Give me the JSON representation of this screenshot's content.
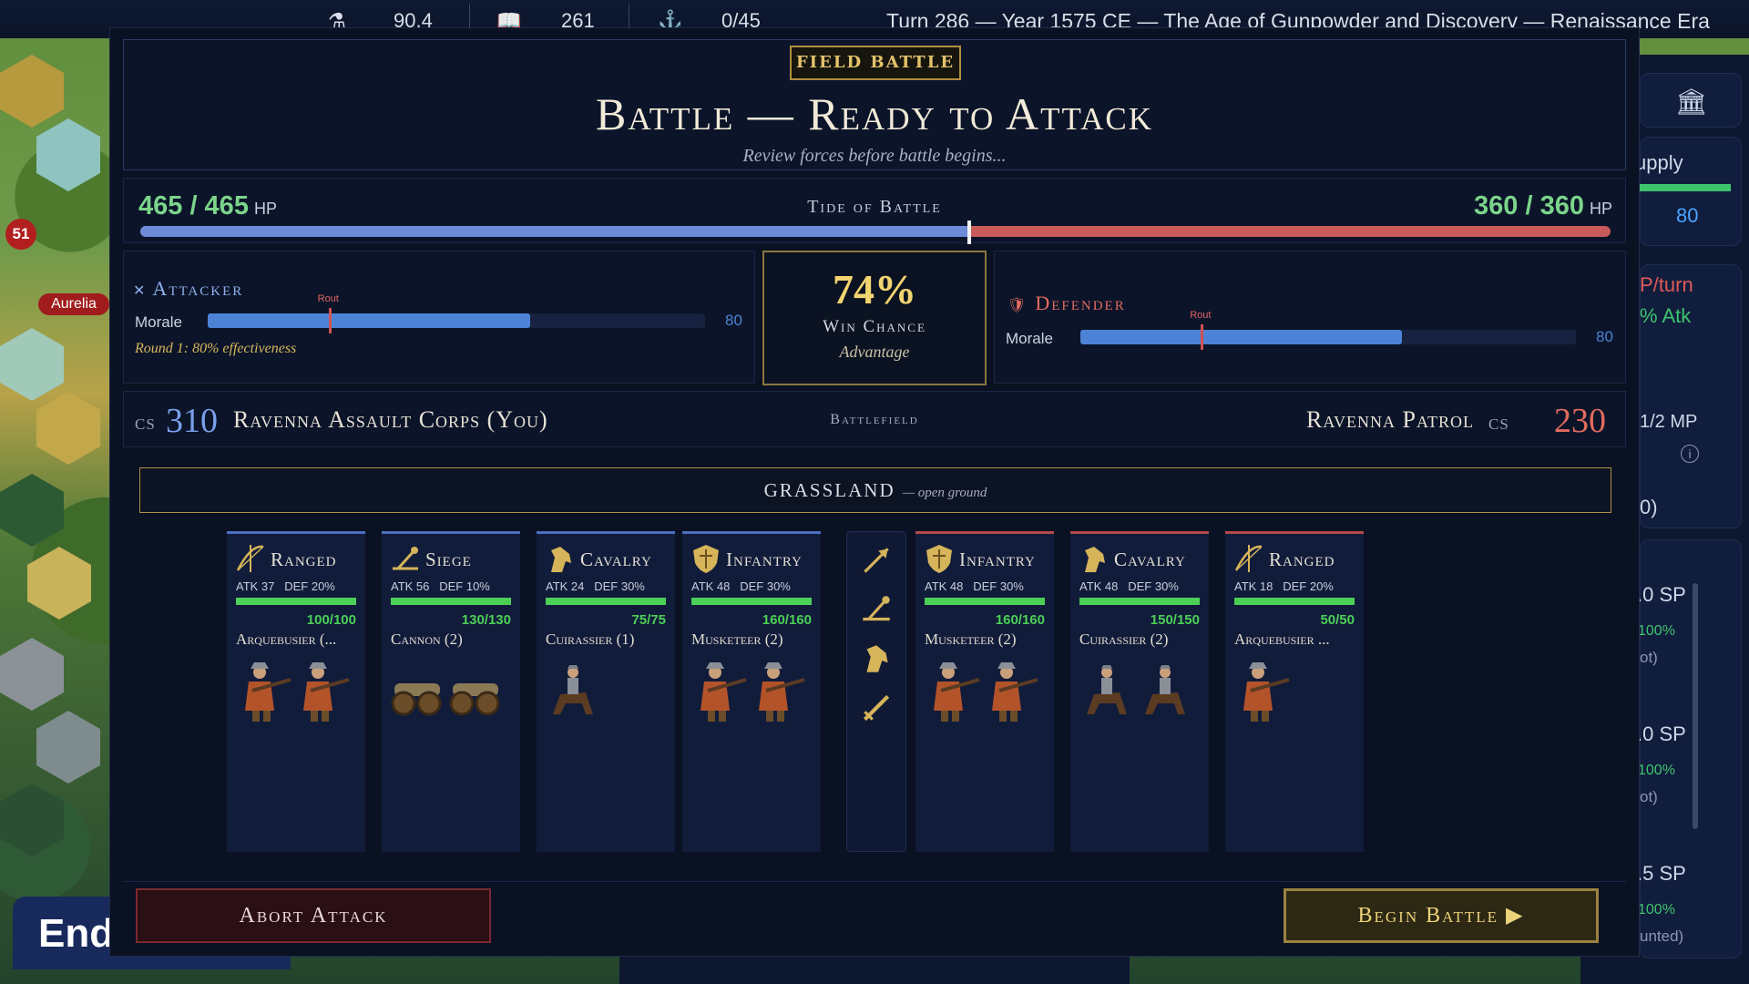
{
  "topbar": {
    "science": "90.4",
    "culture": "261",
    "trade": "0/45",
    "turn_info": "Turn 286 — Year 1575 CE — The Age of Gunpowder and Discovery — Renaissance Era"
  },
  "map": {
    "city_name": "Aurelia",
    "city_pop": "51",
    "end_turn": "End"
  },
  "right_panel": {
    "supply_label": "upply",
    "supply_value": "80",
    "hp_turn": "P/turn",
    "atk_bonus": "% Atk",
    "mp": "1/2 MP",
    "paren": "0)",
    "sp1": ".0 SP",
    "sp1_pct": "100%",
    "sp1_note": "ot)",
    "sp2": ".0 SP",
    "sp2_pct": "100%",
    "sp2_note": "ot)",
    "sp3": ".5 SP",
    "sp3_pct": "100%",
    "sp3_note": "unted)"
  },
  "header": {
    "badge": "FIELD BATTLE",
    "title": "Battle — Ready to Attack",
    "subtitle": "Review forces before battle begins..."
  },
  "tide": {
    "label": "Tide of Battle",
    "attacker_hp": "465 / 465",
    "defender_hp": "360 / 360",
    "hp_unit": "HP",
    "attacker_share": 0.564
  },
  "attacker": {
    "title": "Attacker",
    "morale_label": "Morale",
    "morale_value": "80",
    "morale_fraction": 0.8,
    "rout_label": "Rout",
    "rout_fraction": 0.3,
    "round_note": "Round 1: 80% effectiveness"
  },
  "defender": {
    "title": "Defender",
    "morale_label": "Morale",
    "morale_value": "80",
    "morale_fraction": 0.8,
    "rout_label": "Rout",
    "rout_fraction": 0.3
  },
  "win": {
    "percent": "74%",
    "label": "Win Chance",
    "advantage": "Advantage"
  },
  "forces": {
    "cs_label": "CS",
    "attacker_cs": "310",
    "attacker_name": "Ravenna Assault Corps (You)",
    "battlefield_label": "Battlefield",
    "defender_name": "Ravenna Patrol",
    "defender_cs": "230"
  },
  "terrain": {
    "name": "GRASSLAND",
    "desc": "— open ground"
  },
  "units": [
    {
      "type": "Ranged",
      "icon": "bow-icon",
      "stats": "ATK 37   DEF 20%",
      "hp": "100/100",
      "name": "Arquebusier (...",
      "side": "att",
      "figs": 2,
      "fig": "musketeer"
    },
    {
      "type": "Siege",
      "icon": "catapult-icon",
      "stats": "ATK 56   DEF 10%",
      "hp": "130/130",
      "name": "Cannon (2)",
      "side": "att",
      "figs": 2,
      "fig": "cannon"
    },
    {
      "type": "Cavalry",
      "icon": "horse-icon",
      "stats": "ATK 24   DEF 30%",
      "hp": "75/75",
      "name": "Cuirassier (1)",
      "side": "att",
      "figs": 1,
      "fig": "rider"
    },
    {
      "type": "Infantry",
      "icon": "shield-icon",
      "stats": "ATK 48   DEF 30%",
      "hp": "160/160",
      "name": "Musketeer (2)",
      "side": "att",
      "figs": 2,
      "fig": "musketeer"
    },
    {
      "type": "Infantry",
      "icon": "shield-icon",
      "stats": "ATK 48   DEF 30%",
      "hp": "160/160",
      "name": "Musketeer (2)",
      "side": "def",
      "figs": 2,
      "fig": "musketeer"
    },
    {
      "type": "Cavalry",
      "icon": "horse-icon",
      "stats": "ATK 48   DEF 30%",
      "hp": "150/150",
      "name": "Cuirassier (2)",
      "side": "def",
      "figs": 2,
      "fig": "rider"
    },
    {
      "type": "Ranged",
      "icon": "bow-icon",
      "stats": "ATK 18   DEF 20%",
      "hp": "50/50",
      "name": "Arquebusier ...",
      "side": "def",
      "figs": 1,
      "fig": "musketeer"
    }
  ],
  "buttons": {
    "abort": "Abort Attack",
    "begin": "Begin Battle ▶"
  },
  "colors": {
    "attacker_blue": "#6d8ad8",
    "defender_red": "#c85a5a",
    "gold": "#e3c26b",
    "hp_green": "#4ccf56"
  }
}
